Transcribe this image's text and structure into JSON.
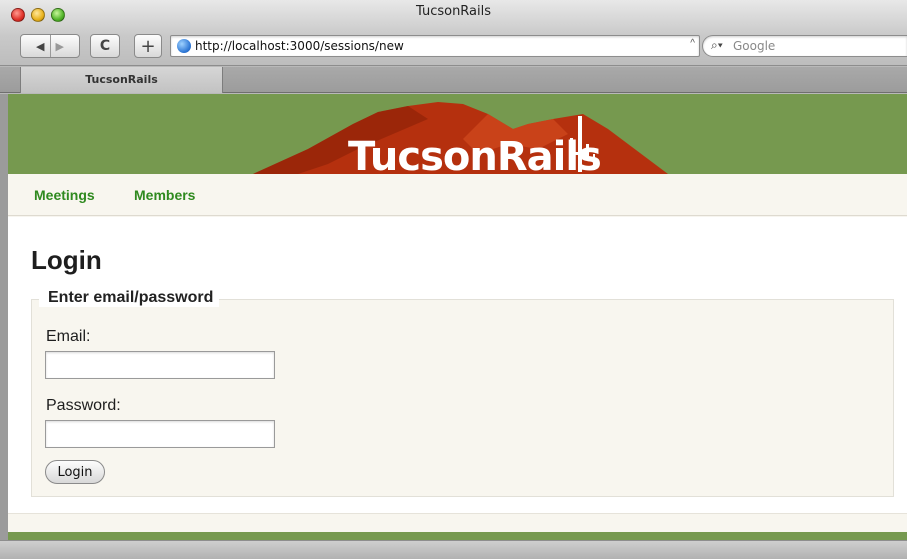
{
  "window": {
    "title": "TucsonRails",
    "url": "http://localhost:3000/sessions/new",
    "search_placeholder": "Google",
    "tab_label": "TucsonRails"
  },
  "toolbar": {
    "back_icon": "back-arrow-icon",
    "forward_icon": "forward-arrow-icon",
    "reload_icon": "reload-icon",
    "add_bookmark_icon": "plus-icon",
    "reload_glyph": "C",
    "add_glyph": "+"
  },
  "site": {
    "logo_text": "TucsonRails",
    "brand_color": "#76994f",
    "mountain_color": "#b5300e",
    "nav": [
      {
        "label": "Meetings"
      },
      {
        "label": "Members"
      }
    ]
  },
  "login": {
    "title": "Login",
    "legend": "Enter email/password",
    "email_label": "Email:",
    "email_value": "",
    "password_label": "Password:",
    "password_value": "",
    "button_label": "Login"
  }
}
